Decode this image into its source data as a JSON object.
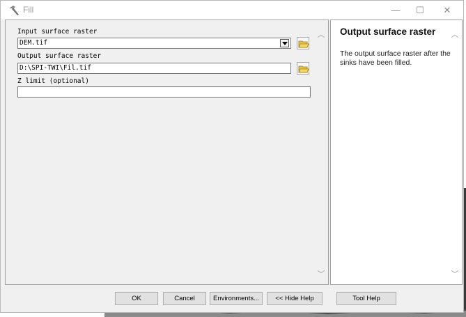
{
  "window": {
    "title": "Fill",
    "minimize_glyph": "—",
    "maximize_glyph": "☐",
    "close_glyph": "✕"
  },
  "params": {
    "input_label": "Input surface raster",
    "input_value": "DEM.tif",
    "output_label": "Output surface raster",
    "output_value": "D:\\SPI-TWI\\Fil.tif",
    "zlimit_label": "Z limit (optional)",
    "zlimit_value": ""
  },
  "help": {
    "title": "Output surface raster",
    "body": "The output surface raster after the sinks have been filled."
  },
  "buttons": {
    "ok": "OK",
    "cancel": "Cancel",
    "environments": "Environments...",
    "hide_help": "<< Hide Help",
    "tool_help": "Tool Help"
  },
  "icons": {
    "title_icon": "hammer-icon",
    "browse_icon": "folder-open-icon"
  }
}
